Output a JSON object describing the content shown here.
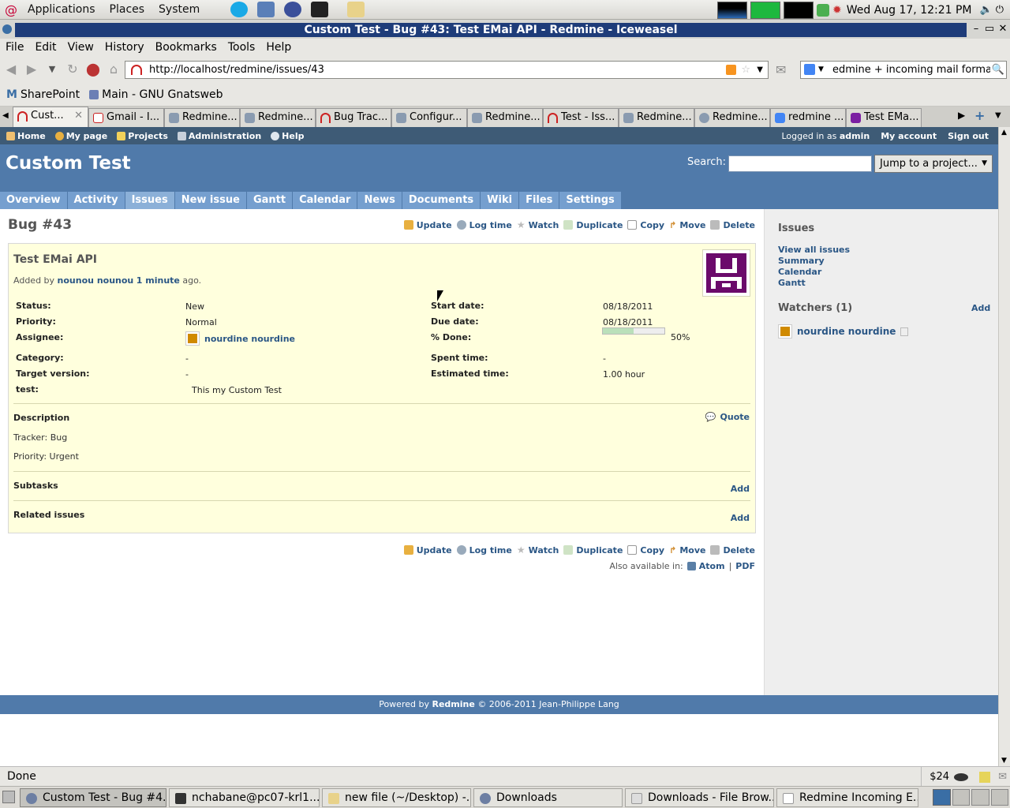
{
  "panel": {
    "menus": [
      "Applications",
      "Places",
      "System"
    ],
    "clock": "Wed Aug 17, 12:21 PM"
  },
  "window": {
    "title": "Custom Test - Bug #43: Test EMai API - Redmine - Iceweasel"
  },
  "menubar": [
    "File",
    "Edit",
    "View",
    "History",
    "Bookmarks",
    "Tools",
    "Help"
  ],
  "navbar": {
    "url": "http://localhost/redmine/issues/43",
    "search_value": "edmine + incoming mail format"
  },
  "bookmarks": [
    "SharePoint",
    "Main - GNU Gnatsweb"
  ],
  "tabs": [
    {
      "label": "Cust..."
    },
    {
      "label": "Gmail - I..."
    },
    {
      "label": "Redmine..."
    },
    {
      "label": "Redmine..."
    },
    {
      "label": "Bug Trac..."
    },
    {
      "label": "Configur..."
    },
    {
      "label": "Redmine..."
    },
    {
      "label": "Test - Iss..."
    },
    {
      "label": "Redmine..."
    },
    {
      "label": "Redmine..."
    },
    {
      "label": "redmine ..."
    },
    {
      "label": "Test EMa..."
    }
  ],
  "redmine": {
    "top_menu": [
      "Home",
      "My page",
      "Projects",
      "Administration",
      "Help"
    ],
    "logged_in_prefix": "Logged in as",
    "logged_in_user": "admin",
    "my_account": "My account",
    "sign_out": "Sign out",
    "project_title": "Custom Test",
    "search_label": "Search:",
    "jump_label": "Jump to a project...",
    "main_menu": [
      "Overview",
      "Activity",
      "Issues",
      "New issue",
      "Gantt",
      "Calendar",
      "News",
      "Documents",
      "Wiki",
      "Files",
      "Settings"
    ],
    "selected_menu": "Issues",
    "actions": [
      "Update",
      "Log time",
      "Watch",
      "Duplicate",
      "Copy",
      "Move",
      "Delete"
    ],
    "issue": {
      "heading": "Bug #43",
      "subject": "Test EMai API",
      "added_by_prefix": "Added by",
      "author": "nounou nounou",
      "age": "1 minute",
      "ago": "ago.",
      "attrs_left": [
        {
          "label": "Status:",
          "value": "New"
        },
        {
          "label": "Priority:",
          "value": "Normal"
        },
        {
          "label": "Assignee:",
          "value": "nourdine nourdine"
        },
        {
          "label": "Category:",
          "value": "-"
        },
        {
          "label": "Target version:",
          "value": "-"
        },
        {
          "label": "test:",
          "value": "This my Custom Test"
        }
      ],
      "attrs_right": [
        {
          "label": "Start date:",
          "value": "08/18/2011"
        },
        {
          "label": "Due date:",
          "value": "08/18/2011"
        },
        {
          "label": "% Done:",
          "value": "50%"
        },
        {
          "label": "Spent time:",
          "value": "-"
        },
        {
          "label": "Estimated time:",
          "value": "1.00 hour"
        }
      ],
      "done_fraction": 0.5,
      "description_title": "Description",
      "quote": "Quote",
      "description_lines": [
        "Tracker: Bug",
        "Priority: Urgent"
      ],
      "subtasks_title": "Subtasks",
      "related_title": "Related issues",
      "add": "Add"
    },
    "also_available": "Also available in:",
    "formats": [
      "Atom",
      "PDF"
    ],
    "sidebar": {
      "issues_title": "Issues",
      "links": [
        "View all issues",
        "Summary",
        "Calendar",
        "Gantt"
      ],
      "watchers_title": "Watchers (1)",
      "watchers_add": "Add",
      "watcher": "nourdine nourdine"
    },
    "footer_prefix": "Powered by",
    "footer_brand": "Redmine",
    "footer_suffix": "© 2006-2011 Jean-Philippe Lang"
  },
  "statusbar": {
    "text": "Done",
    "price": "$24"
  },
  "taskbar": [
    {
      "label": "Custom Test - Bug #4..."
    },
    {
      "label": "nchabane@pc07-krl1..."
    },
    {
      "label": "new file (~/Desktop) -..."
    },
    {
      "label": "Downloads"
    },
    {
      "label": "Downloads - File Brow..."
    },
    {
      "label": "Redmine Incoming E..."
    }
  ],
  "colors": {
    "header": "#507aaa",
    "top_menu": "#3e5b76",
    "issue_bg": "#ffffdd",
    "link": "#2a5685",
    "title_bar": "#1e3c79"
  }
}
